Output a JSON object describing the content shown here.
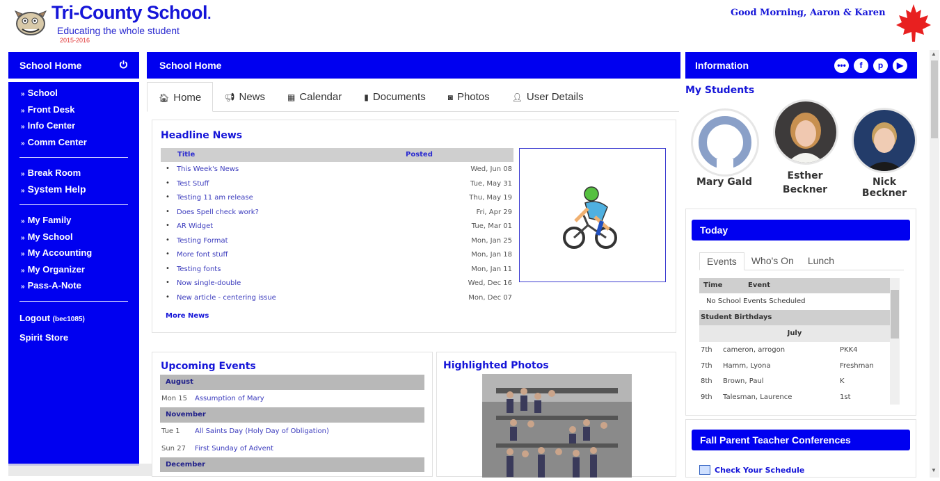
{
  "header": {
    "school_name": "Tri-County School",
    "tagline": "Educating the whole student",
    "year": "2015-2016",
    "greeting": "Good Morning, Aaron & Karen"
  },
  "left_sidebar": {
    "title": "School Home",
    "group1": [
      "School",
      "Front Desk",
      "Info Center",
      "Comm Center"
    ],
    "group2": [
      "Break Room",
      "System Help"
    ],
    "group3": [
      "My Family",
      "My School",
      "My Accounting",
      "My Organizer",
      "Pass-A-Note"
    ],
    "logout_label": "Logout",
    "logout_user": "(bec1085)",
    "spirit_store": "Spirit Store"
  },
  "center": {
    "title": "School Home",
    "tabs": [
      {
        "icon": "home-icon",
        "label": "Home"
      },
      {
        "icon": "megaphone-icon",
        "label": "News"
      },
      {
        "icon": "calendar-icon",
        "label": "Calendar"
      },
      {
        "icon": "document-icon",
        "label": "Documents"
      },
      {
        "icon": "camera-icon",
        "label": "Photos"
      },
      {
        "icon": "user-icon",
        "label": "User Details"
      }
    ],
    "headline": {
      "title": "Headline News",
      "col_title": "Title",
      "col_posted": "Posted",
      "items": [
        {
          "title": "This Week's News",
          "posted": "Wed, Jun 08"
        },
        {
          "title": "Test Stuff",
          "posted": "Tue, May 31"
        },
        {
          "title": "Testing 11 am release",
          "posted": "Thu, May 19"
        },
        {
          "title": "Does Spell check work?",
          "posted": "Fri, Apr 29"
        },
        {
          "title": "AR Widget",
          "posted": "Tue, Mar 01"
        },
        {
          "title": "Testing Format",
          "posted": "Mon, Jan 25"
        },
        {
          "title": "More font stuff",
          "posted": "Mon, Jan 18"
        },
        {
          "title": "Testing fonts",
          "posted": "Mon, Jan 11"
        },
        {
          "title": "Now single-double",
          "posted": "Wed, Dec 16"
        },
        {
          "title": "New article - centering issue",
          "posted": "Mon, Dec 07"
        }
      ],
      "more": "More News"
    },
    "events": {
      "title": "Upcoming Events",
      "months": [
        {
          "month": "August",
          "rows": [
            {
              "day": "Mon  15",
              "text": "Assumption of Mary"
            }
          ]
        },
        {
          "month": "November",
          "rows": [
            {
              "day": "Tue  1",
              "text": "All Saints Day (Holy Day of Obligation)"
            },
            {
              "day": "Sun  27",
              "text": "First Sunday of Advent"
            }
          ]
        },
        {
          "month": "December",
          "rows": []
        }
      ]
    },
    "photos": {
      "title": "Highlighted Photos"
    }
  },
  "right": {
    "info_title": "Information",
    "my_students_title": "My Students",
    "students": [
      "Mary Gald",
      "Esther Beckner",
      "Nick Beckner"
    ],
    "today": {
      "title": "Today",
      "tabs": [
        "Events",
        "Who's On",
        "Lunch"
      ],
      "col_time": "Time",
      "col_event": "Event",
      "no_events": "No School Events Scheduled",
      "birthdays_label": "Student Birthdays",
      "month": "July",
      "birthdays": [
        {
          "day": "7th",
          "name": "cameron, arrogon",
          "grade": "PKK4"
        },
        {
          "day": "7th",
          "name": "Hamm, Lyona",
          "grade": "Freshman"
        },
        {
          "day": "8th",
          "name": "Brown, Paul",
          "grade": "K"
        },
        {
          "day": "9th",
          "name": "Talesman, Laurence",
          "grade": "1st"
        }
      ]
    },
    "conferences": {
      "title": "Fall Parent Teacher Conferences",
      "link": "Check Your Schedule"
    }
  },
  "colors": {
    "primary": "#0000f0",
    "link": "#1515d8"
  }
}
